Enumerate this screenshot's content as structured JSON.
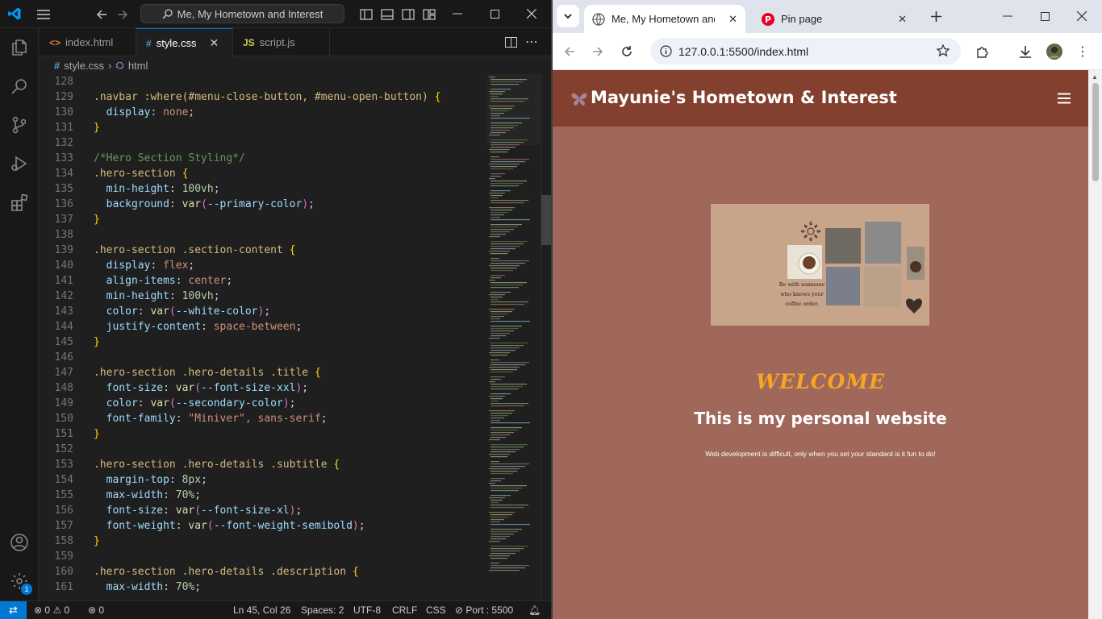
{
  "vscode": {
    "title_search": "Me, My Hometown and Interest",
    "tabs": [
      {
        "label": "index.html",
        "icon": "html-file-icon",
        "active": false
      },
      {
        "label": "style.css",
        "icon": "css-file-icon",
        "active": true
      },
      {
        "label": "script.js",
        "icon": "js-file-icon",
        "active": false
      }
    ],
    "breadcrumb": {
      "file": "style.css",
      "symbol": "html"
    },
    "code_lines": [
      {
        "n": "128",
        "tokens": []
      },
      {
        "n": "129",
        "tokens": [
          [
            "t-sel",
            ".navbar :where(#menu-close-button, #menu-open-button) "
          ],
          [
            "t-br",
            "{"
          ]
        ]
      },
      {
        "n": "130",
        "tokens": [
          [
            "t-prop",
            "  display"
          ],
          [
            "t-pun",
            ": "
          ],
          [
            "t-val",
            "none"
          ],
          [
            "t-pun",
            ";"
          ]
        ]
      },
      {
        "n": "131",
        "tokens": [
          [
            "t-br",
            "}"
          ]
        ]
      },
      {
        "n": "132",
        "tokens": []
      },
      {
        "n": "133",
        "tokens": [
          [
            "t-com",
            "/*Hero Section Styling*/"
          ]
        ]
      },
      {
        "n": "134",
        "tokens": [
          [
            "t-sel",
            ".hero-section "
          ],
          [
            "t-br",
            "{"
          ]
        ]
      },
      {
        "n": "135",
        "tokens": [
          [
            "t-prop",
            "  min-height"
          ],
          [
            "t-pun",
            ": "
          ],
          [
            "t-num",
            "100vh"
          ],
          [
            "t-pun",
            ";"
          ]
        ]
      },
      {
        "n": "136",
        "tokens": [
          [
            "t-prop",
            "  background"
          ],
          [
            "t-pun",
            ": "
          ],
          [
            "t-fn",
            "var"
          ],
          [
            "t-br2",
            "("
          ],
          [
            "t-prop",
            "--primary-color"
          ],
          [
            "t-br2",
            ")"
          ],
          [
            "t-pun",
            ";"
          ]
        ]
      },
      {
        "n": "137",
        "tokens": [
          [
            "t-br",
            "}"
          ]
        ]
      },
      {
        "n": "138",
        "tokens": []
      },
      {
        "n": "139",
        "tokens": [
          [
            "t-sel",
            ".hero-section .section-content "
          ],
          [
            "t-br",
            "{"
          ]
        ]
      },
      {
        "n": "140",
        "tokens": [
          [
            "t-prop",
            "  display"
          ],
          [
            "t-pun",
            ": "
          ],
          [
            "t-val",
            "flex"
          ],
          [
            "t-pun",
            ";"
          ]
        ]
      },
      {
        "n": "141",
        "tokens": [
          [
            "t-prop",
            "  align-items"
          ],
          [
            "t-pun",
            ": "
          ],
          [
            "t-val",
            "center"
          ],
          [
            "t-pun",
            ";"
          ]
        ]
      },
      {
        "n": "142",
        "tokens": [
          [
            "t-prop",
            "  min-height"
          ],
          [
            "t-pun",
            ": "
          ],
          [
            "t-num",
            "100vh"
          ],
          [
            "t-pun",
            ";"
          ]
        ]
      },
      {
        "n": "143",
        "tokens": [
          [
            "t-prop",
            "  color"
          ],
          [
            "t-pun",
            ": "
          ],
          [
            "t-fn",
            "var"
          ],
          [
            "t-br2",
            "("
          ],
          [
            "t-prop",
            "--white-color"
          ],
          [
            "t-br2",
            ")"
          ],
          [
            "t-pun",
            ";"
          ]
        ]
      },
      {
        "n": "144",
        "tokens": [
          [
            "t-prop",
            "  justify-content"
          ],
          [
            "t-pun",
            ": "
          ],
          [
            "t-val",
            "space-between"
          ],
          [
            "t-pun",
            ";"
          ]
        ]
      },
      {
        "n": "145",
        "tokens": [
          [
            "t-br",
            "}"
          ]
        ]
      },
      {
        "n": "146",
        "tokens": []
      },
      {
        "n": "147",
        "tokens": [
          [
            "t-sel",
            ".hero-section .hero-details .title "
          ],
          [
            "t-br",
            "{"
          ]
        ]
      },
      {
        "n": "148",
        "tokens": [
          [
            "t-prop",
            "  font-size"
          ],
          [
            "t-pun",
            ": "
          ],
          [
            "t-fn",
            "var"
          ],
          [
            "t-br2",
            "("
          ],
          [
            "t-prop",
            "--font-size-xxl"
          ],
          [
            "t-br2",
            ")"
          ],
          [
            "t-pun",
            ";"
          ]
        ]
      },
      {
        "n": "149",
        "tokens": [
          [
            "t-prop",
            "  color"
          ],
          [
            "t-pun",
            ": "
          ],
          [
            "t-fn",
            "var"
          ],
          [
            "t-br2",
            "("
          ],
          [
            "t-prop",
            "--secondary-color"
          ],
          [
            "t-br2",
            ")"
          ],
          [
            "t-pun",
            ";"
          ]
        ]
      },
      {
        "n": "150",
        "tokens": [
          [
            "t-prop",
            "  font-family"
          ],
          [
            "t-pun",
            ": "
          ],
          [
            "t-val",
            "\"Miniver\", sans-serif"
          ],
          [
            "t-pun",
            ";"
          ]
        ]
      },
      {
        "n": "151",
        "tokens": [
          [
            "t-br",
            "}"
          ]
        ]
      },
      {
        "n": "152",
        "tokens": []
      },
      {
        "n": "153",
        "tokens": [
          [
            "t-sel",
            ".hero-section .hero-details .subtitle "
          ],
          [
            "t-br",
            "{"
          ]
        ]
      },
      {
        "n": "154",
        "tokens": [
          [
            "t-prop",
            "  margin-top"
          ],
          [
            "t-pun",
            ": "
          ],
          [
            "t-num",
            "8px"
          ],
          [
            "t-pun",
            ";"
          ]
        ]
      },
      {
        "n": "155",
        "tokens": [
          [
            "t-prop",
            "  max-width"
          ],
          [
            "t-pun",
            ": "
          ],
          [
            "t-num",
            "70%"
          ],
          [
            "t-pun",
            ";"
          ]
        ]
      },
      {
        "n": "156",
        "tokens": [
          [
            "t-prop",
            "  font-size"
          ],
          [
            "t-pun",
            ": "
          ],
          [
            "t-fn",
            "var"
          ],
          [
            "t-br2",
            "("
          ],
          [
            "t-prop",
            "--font-size-xl"
          ],
          [
            "t-br2",
            ")"
          ],
          [
            "t-pun",
            ";"
          ]
        ]
      },
      {
        "n": "157",
        "tokens": [
          [
            "t-prop",
            "  font-weight"
          ],
          [
            "t-pun",
            ": "
          ],
          [
            "t-fn",
            "var"
          ],
          [
            "t-br2",
            "("
          ],
          [
            "t-prop",
            "--font-weight-semibold"
          ],
          [
            "t-br2",
            ")"
          ],
          [
            "t-pun",
            ";"
          ]
        ]
      },
      {
        "n": "158",
        "tokens": [
          [
            "t-br",
            "}"
          ]
        ]
      },
      {
        "n": "159",
        "tokens": []
      },
      {
        "n": "160",
        "tokens": [
          [
            "t-sel",
            ".hero-section .hero-details .description "
          ],
          [
            "t-br",
            "{"
          ]
        ]
      },
      {
        "n": "161",
        "tokens": [
          [
            "t-prop",
            "  max-width"
          ],
          [
            "t-pun",
            ": "
          ],
          [
            "t-num",
            "70%"
          ],
          [
            "t-pun",
            ";"
          ]
        ]
      }
    ],
    "status": {
      "errors": "0",
      "warnings": "0",
      "ports": "0",
      "position": "Ln 45, Col 26",
      "spaces": "Spaces: 2",
      "encoding": "UTF-8",
      "eol": "CRLF",
      "language": "CSS",
      "port": "Port : 5500"
    },
    "settings_badge": "1"
  },
  "browser": {
    "tabs": [
      {
        "label": "Me, My Hometown and In",
        "icon": "globe-icon",
        "active": true
      },
      {
        "label": "Pin page",
        "icon": "pinterest-icon",
        "active": false
      }
    ],
    "url": "127.0.0.1:5500/index.html",
    "site": {
      "title": "Mayunie's Hometown & Interest",
      "welcome": "WELCOME",
      "subtitle": "This is my personal website",
      "description": "Web development is difficult, only when you set your standard is it fun to do!",
      "image_text": "Be with someone who knows your coffee order."
    }
  },
  "colors": {
    "site_nav": "#83402f",
    "site_bg": "#a0685a",
    "welcome": "#f5a623",
    "vscode_accent": "#0078d4"
  }
}
